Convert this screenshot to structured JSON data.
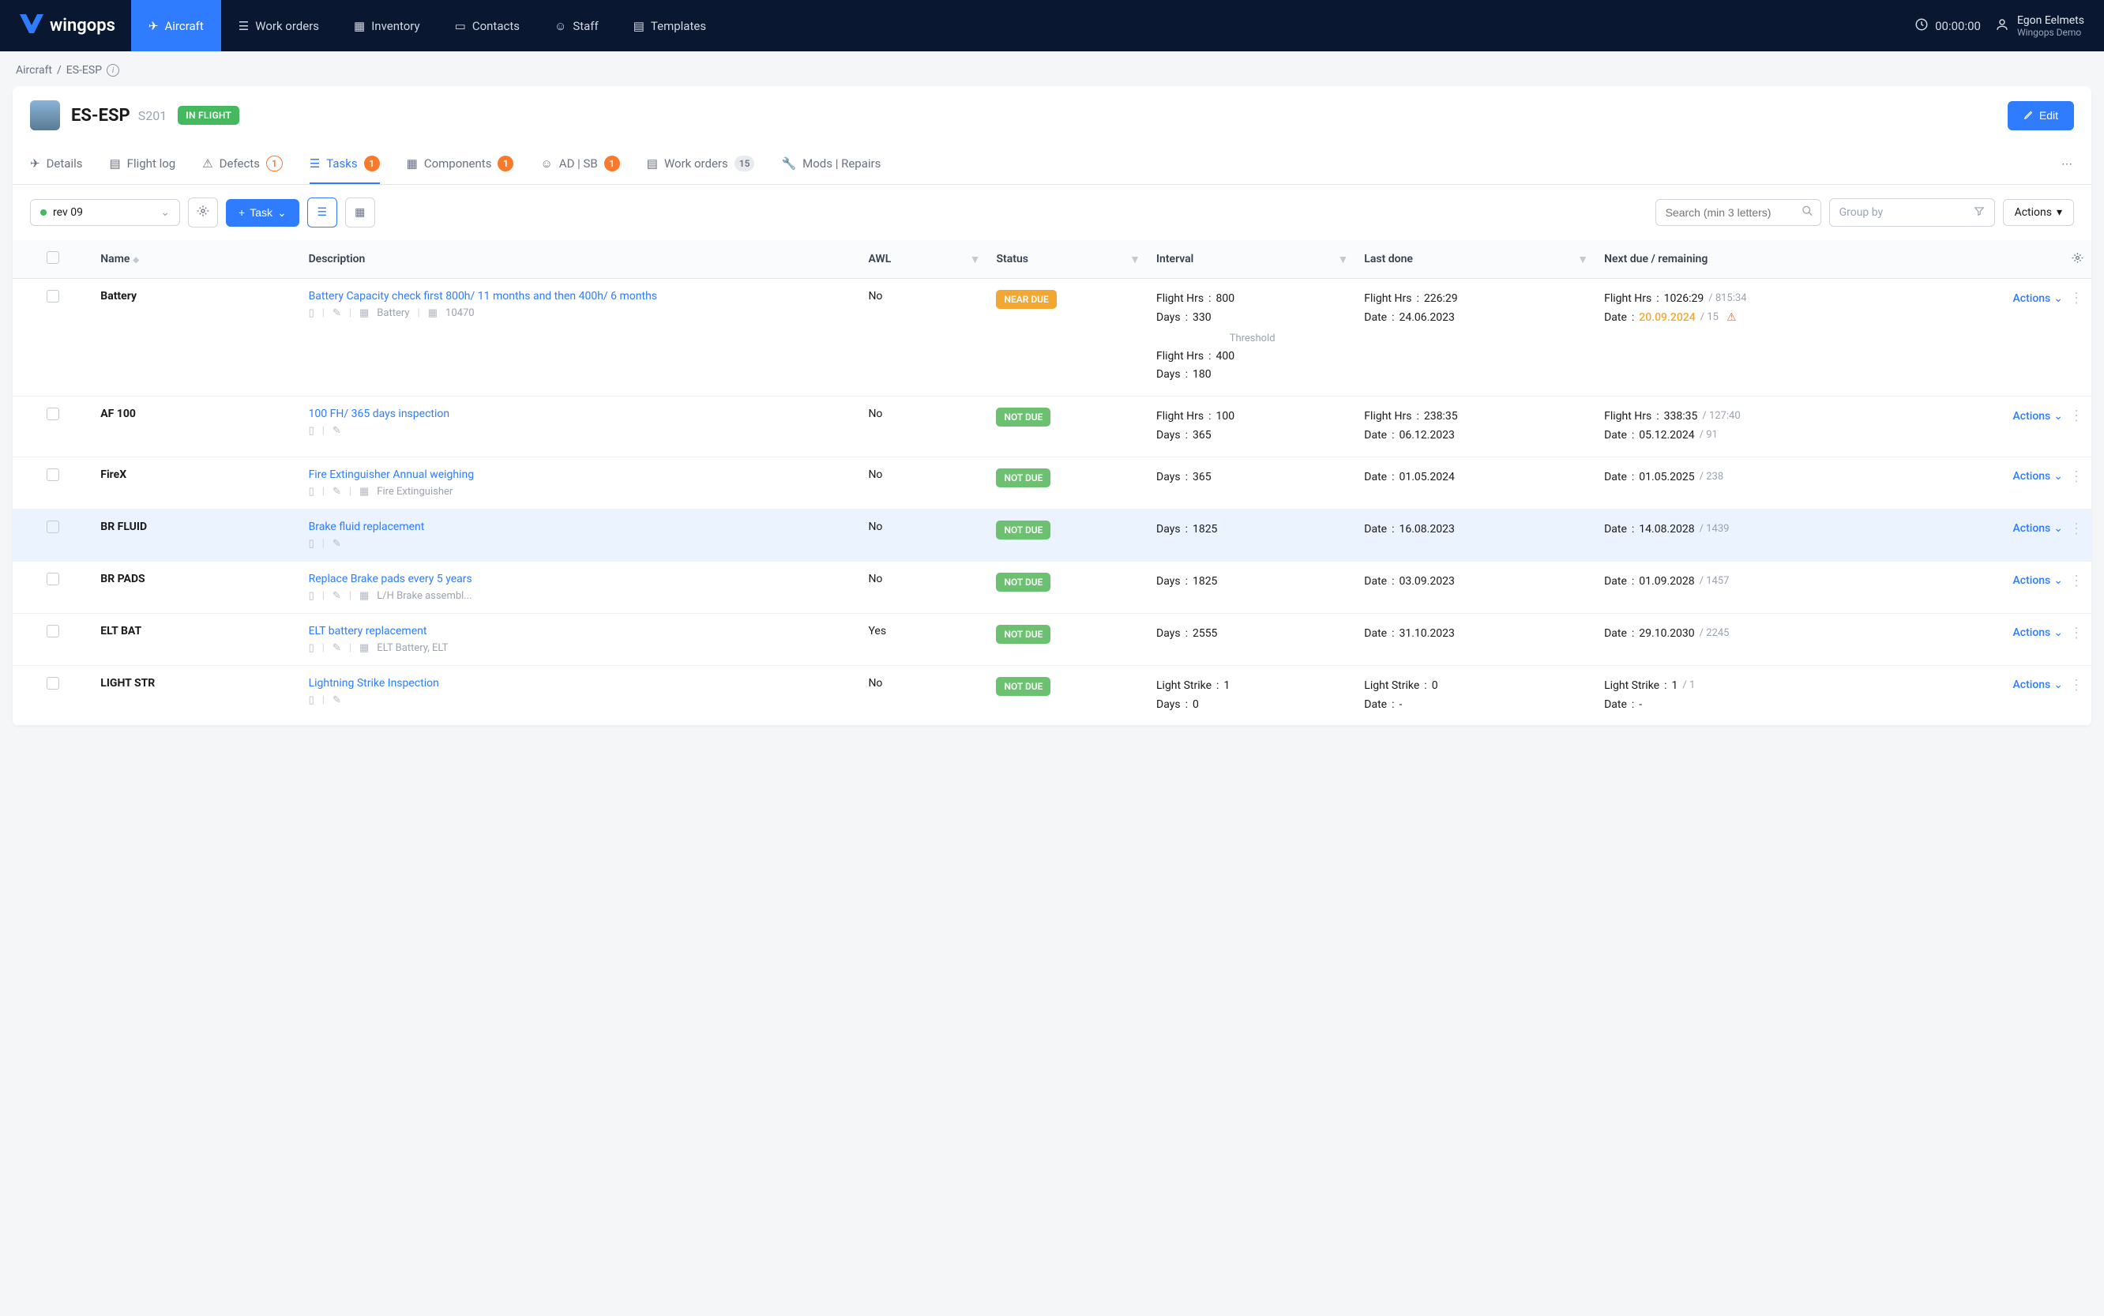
{
  "brand": "wingops",
  "nav": {
    "aircraft": "Aircraft",
    "work_orders": "Work orders",
    "inventory": "Inventory",
    "contacts": "Contacts",
    "staff": "Staff",
    "templates": "Templates"
  },
  "clock": "00:00:00",
  "user": {
    "name": "Egon Eelmets",
    "org": "Wingops Demo"
  },
  "breadcrumb": {
    "root": "Aircraft",
    "current": "ES-ESP"
  },
  "aircraft": {
    "reg": "ES-ESP",
    "type": "S201",
    "status": "IN FLIGHT",
    "edit": "Edit"
  },
  "tabs": {
    "details": "Details",
    "flight_log": "Flight log",
    "defects": "Defects",
    "defects_count": "1",
    "tasks": "Tasks",
    "tasks_count": "1",
    "components": "Components",
    "components_count": "1",
    "adsb": "AD | SB",
    "adsb_count": "1",
    "work_orders": "Work orders",
    "work_orders_count": "15",
    "mods": "Mods | Repairs"
  },
  "toolbar": {
    "rev": "rev 09",
    "add_task": "Task",
    "search_placeholder": "Search (min 3 letters)",
    "group_placeholder": "Group by",
    "actions": "Actions"
  },
  "columns": {
    "name": "Name",
    "description": "Description",
    "awl": "AWL",
    "status": "Status",
    "interval": "Interval",
    "last": "Last done",
    "next": "Next due / remaining",
    "actions": "Actions"
  },
  "status_labels": {
    "near": "NEAR DUE",
    "notdue": "NOT DUE"
  },
  "threshold_label": "Threshold",
  "rows": [
    {
      "name": "Battery",
      "desc": "Battery Capacity check first 800h/ 11 months and then 400h/ 6 months",
      "meta_parts": [
        "Battery",
        "10470"
      ],
      "awl": "No",
      "status": "near",
      "interval": [
        [
          "Flight Hrs",
          "800"
        ],
        [
          "Days",
          "330"
        ]
      ],
      "threshold": [
        [
          "Flight Hrs",
          "400"
        ],
        [
          "Days",
          "180"
        ]
      ],
      "last": [
        [
          "Flight Hrs",
          "226:29"
        ],
        [
          "Date",
          "24.06.2023"
        ]
      ],
      "next": [
        [
          "Flight Hrs",
          "1026:29",
          "815:34"
        ],
        [
          "Date",
          "20.09.2024",
          "15",
          true
        ]
      ]
    },
    {
      "name": "AF 100",
      "desc": "100 FH/ 365 days inspection",
      "meta_parts": [],
      "awl": "No",
      "status": "notdue",
      "interval": [
        [
          "Flight Hrs",
          "100"
        ],
        [
          "Days",
          "365"
        ]
      ],
      "last": [
        [
          "Flight Hrs",
          "238:35"
        ],
        [
          "Date",
          "06.12.2023"
        ]
      ],
      "next": [
        [
          "Flight Hrs",
          "338:35",
          "127:40"
        ],
        [
          "Date",
          "05.12.2024",
          "91"
        ]
      ]
    },
    {
      "name": "FireX",
      "desc": "Fire Extinguisher Annual weighing",
      "meta_parts": [
        "Fire Extinguisher"
      ],
      "awl": "No",
      "status": "notdue",
      "interval": [
        [
          "Days",
          "365"
        ]
      ],
      "last": [
        [
          "Date",
          "01.05.2024"
        ]
      ],
      "next": [
        [
          "Date",
          "01.05.2025",
          "238"
        ]
      ]
    },
    {
      "name": "BR FLUID",
      "desc": "Brake fluid replacement",
      "meta_parts": [],
      "highlighted": true,
      "awl": "No",
      "status": "notdue",
      "interval": [
        [
          "Days",
          "1825"
        ]
      ],
      "last": [
        [
          "Date",
          "16.08.2023"
        ]
      ],
      "next": [
        [
          "Date",
          "14.08.2028",
          "1439"
        ]
      ]
    },
    {
      "name": "BR PADS",
      "desc": "Replace Brake pads every 5 years",
      "meta_parts": [
        "L/H Brake assembl..."
      ],
      "awl": "No",
      "status": "notdue",
      "interval": [
        [
          "Days",
          "1825"
        ]
      ],
      "last": [
        [
          "Date",
          "03.09.2023"
        ]
      ],
      "next": [
        [
          "Date",
          "01.09.2028",
          "1457"
        ]
      ]
    },
    {
      "name": "ELT BAT",
      "desc": "ELT battery replacement",
      "meta_parts": [
        "ELT Battery, ELT"
      ],
      "awl": "Yes",
      "status": "notdue",
      "interval": [
        [
          "Days",
          "2555"
        ]
      ],
      "last": [
        [
          "Date",
          "31.10.2023"
        ]
      ],
      "next": [
        [
          "Date",
          "29.10.2030",
          "2245"
        ]
      ]
    },
    {
      "name": "LIGHT STR",
      "desc": "Lightning Strike Inspection",
      "meta_parts": [],
      "awl": "No",
      "status": "notdue",
      "interval": [
        [
          "Light Strike",
          "1"
        ],
        [
          "Days",
          "0"
        ]
      ],
      "last": [
        [
          "Light Strike",
          "0"
        ],
        [
          "Date",
          "-"
        ]
      ],
      "next": [
        [
          "Light Strike",
          "1",
          "1"
        ],
        [
          "Date",
          "-"
        ]
      ]
    }
  ]
}
